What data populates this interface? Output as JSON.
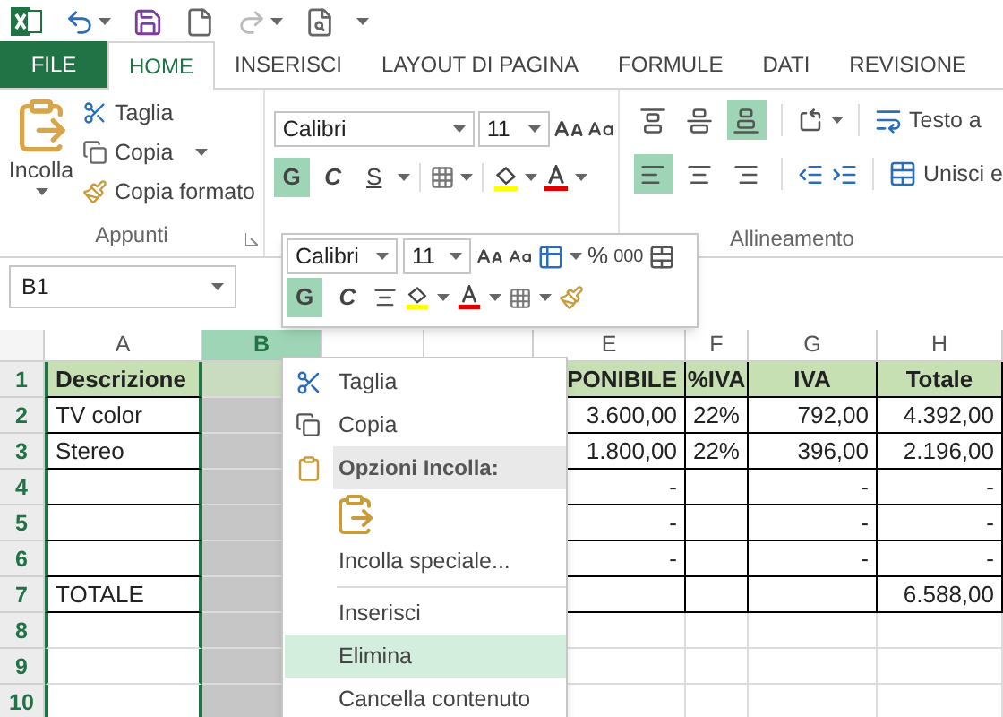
{
  "tabs": [
    {
      "label": "FILE",
      "kind": "file",
      "selected": false
    },
    {
      "label": "HOME",
      "kind": "tab",
      "selected": true
    },
    {
      "label": "INSERISCI",
      "kind": "tab",
      "selected": false
    },
    {
      "label": "LAYOUT DI PAGINA",
      "kind": "tab",
      "selected": false
    },
    {
      "label": "FORMULE",
      "kind": "tab",
      "selected": false
    },
    {
      "label": "DATI",
      "kind": "tab",
      "selected": false
    },
    {
      "label": "REVISIONE",
      "kind": "tab",
      "selected": false
    }
  ],
  "ribbon": {
    "clipboard": {
      "paste": "Incolla",
      "cut": "Taglia",
      "copy": "Copia",
      "format_painter": "Copia formato",
      "label": "Appunti"
    },
    "font": {
      "name": "Calibri",
      "size": "11",
      "styles": [
        {
          "label": "G",
          "selected": true
        },
        {
          "label": "C",
          "selected": false
        },
        {
          "label": "S",
          "selected": false
        }
      ]
    },
    "alignment": {
      "vertical": [
        {
          "selected": false
        },
        {
          "selected": false
        },
        {
          "selected": true
        }
      ],
      "horizontal": [
        {
          "selected": true
        },
        {
          "selected": false
        },
        {
          "selected": false
        }
      ],
      "wrap": "Testo a",
      "merge": "Unisci e",
      "label": "Allineamento"
    }
  },
  "name_box": "B1",
  "columns": [
    {
      "label": "A",
      "selected": false
    },
    {
      "label": "B",
      "selected": true
    },
    {
      "label": "E",
      "selected": false
    },
    {
      "label": "F",
      "selected": false
    },
    {
      "label": "G",
      "selected": false
    },
    {
      "label": "H",
      "selected": false
    }
  ],
  "rows": [
    {
      "number": "1",
      "selected": true,
      "kind": "header",
      "cells": {
        "A": "Descrizione",
        "E": "PONIBILE",
        "F": "%IVA",
        "G": "IVA",
        "H": "Totale"
      }
    },
    {
      "number": "2",
      "selected": true,
      "kind": "item",
      "cells": {
        "A": "TV color",
        "E": "3.600,00",
        "F": "22%",
        "G": "792,00",
        "H": "4.392,00"
      }
    },
    {
      "number": "3",
      "selected": true,
      "kind": "item",
      "cells": {
        "A": "Stereo",
        "E": "1.800,00",
        "F": "22%",
        "G": "396,00",
        "H": "2.196,00"
      }
    },
    {
      "number": "4",
      "selected": true,
      "kind": "item",
      "cells": {
        "E": "-",
        "G": "-",
        "H": "-"
      }
    },
    {
      "number": "5",
      "selected": true,
      "kind": "item",
      "cells": {
        "E": "-",
        "G": "-",
        "H": "-"
      }
    },
    {
      "number": "6",
      "selected": true,
      "kind": "item",
      "cells": {
        "E": "-",
        "G": "-",
        "H": "-"
      }
    },
    {
      "number": "7",
      "selected": true,
      "kind": "total",
      "cells": {
        "A": "TOTALE",
        "H": "6.588,00"
      }
    },
    {
      "number": "8",
      "selected": true,
      "kind": "blank",
      "cells": {}
    },
    {
      "number": "9",
      "selected": true,
      "kind": "blank",
      "cells": {}
    },
    {
      "number": "10",
      "selected": true,
      "kind": "blank",
      "cells": {}
    }
  ],
  "mini_toolbar": {
    "font": "Calibri",
    "size": "11",
    "styles": [
      {
        "label": "G",
        "selected": true
      },
      {
        "label": "C",
        "selected": false
      }
    ],
    "percent": "%",
    "thousands": "000"
  },
  "context_menu": [
    {
      "kind": "command",
      "label": "Taglia",
      "selected": false
    },
    {
      "kind": "command",
      "label": "Copia",
      "selected": false
    },
    {
      "kind": "section",
      "label": "Opzioni Incolla:"
    },
    {
      "kind": "paste_option"
    },
    {
      "kind": "command",
      "label": "Incolla speciale...",
      "selected": false
    },
    {
      "kind": "separator"
    },
    {
      "kind": "command",
      "label": "Inserisci",
      "selected": false
    },
    {
      "kind": "command",
      "label": "Elimina",
      "selected": true
    },
    {
      "kind": "command",
      "label": "Cancella contenuto",
      "selected": false
    }
  ]
}
